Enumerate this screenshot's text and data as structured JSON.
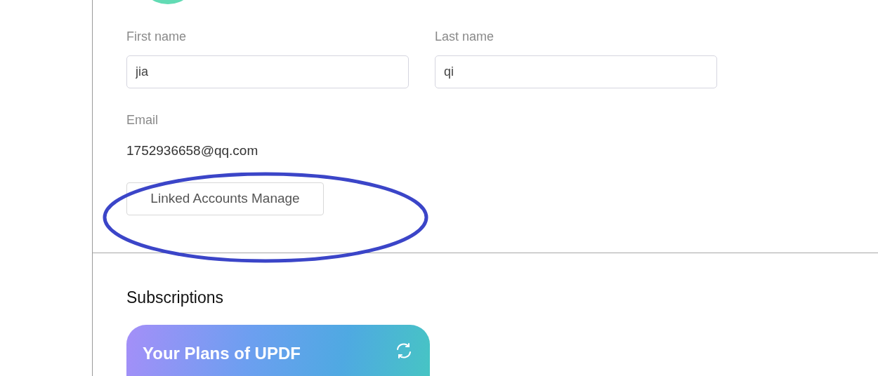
{
  "profile": {
    "fields": [
      {
        "label": "First name",
        "value": "jia"
      },
      {
        "label": "Last name",
        "value": "qi"
      }
    ],
    "email": {
      "label": "Email",
      "value": "1752936658@qq.com"
    },
    "linked_accounts_button": "Linked Accounts Manage"
  },
  "subscriptions": {
    "heading": "Subscriptions",
    "plan_card": {
      "title": "Your Plans of UPDF"
    }
  }
}
